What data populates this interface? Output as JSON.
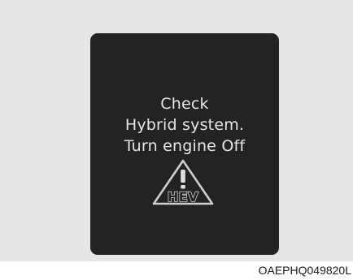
{
  "message": {
    "line1": "Check",
    "line2": "Hybrid system.",
    "line3": "Turn engine Off"
  },
  "warning_icon": {
    "name": "hev-warning-icon",
    "label": "HEV"
  },
  "image_code": "OAEPHQ049820L",
  "colors": {
    "background": "#e6e6e6",
    "display": "#232323",
    "text": "#e6e6e6"
  }
}
